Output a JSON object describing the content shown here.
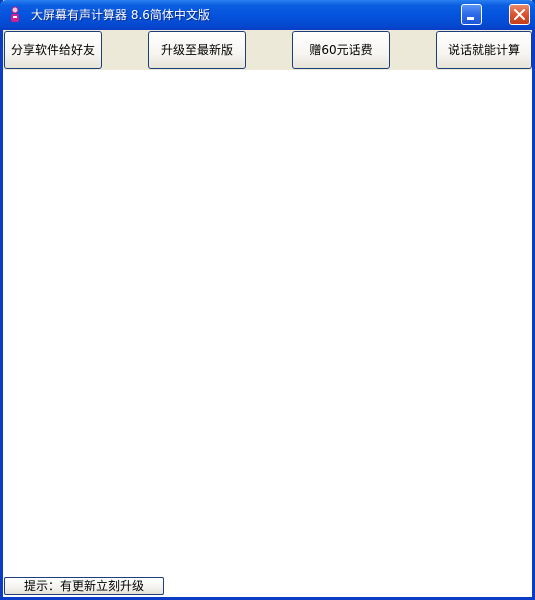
{
  "window": {
    "title": "大屏幕有声计算器 8.6简体中文版",
    "app_icon": "calculator-person-icon",
    "minimize_icon": "minimize-icon",
    "close_icon": "close-icon"
  },
  "toolbar": {
    "share_label": "分享软件给好友",
    "upgrade_label": "升级至最新版",
    "gift_label": "赠60元话费",
    "voice_label": "说话就能计算"
  },
  "status": {
    "tip_label": "提示：有更新立刻升级"
  },
  "colors": {
    "titlebar": "#0553dd",
    "frame": "#0a3cc6",
    "toolbar_bg": "#ece9d8",
    "close": "#d9532f"
  }
}
